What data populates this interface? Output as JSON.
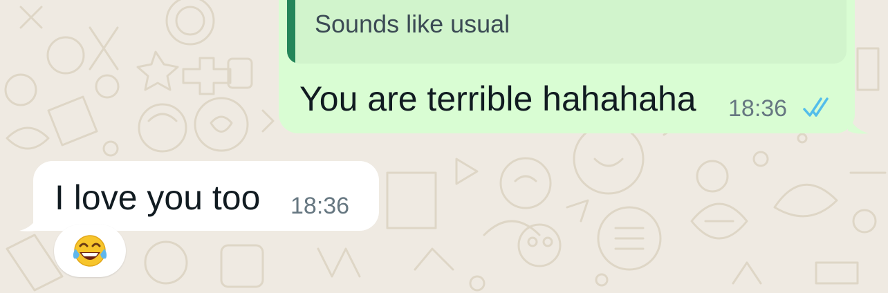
{
  "colors": {
    "chat_background": "#efeae2",
    "outgoing_bubble": "#d9fdd3",
    "quoted_background": "#d1f4cc",
    "quote_bar": "#25865a",
    "incoming_bubble": "#ffffff",
    "read_ticks": "#53bdeb",
    "timestamp": "#667781"
  },
  "outgoing": {
    "quoted_text": "Sounds like usual",
    "text": "You are terrible hahahaha",
    "time": "18:36",
    "status_icon": "double-check-read-icon"
  },
  "incoming": {
    "text": "I love you too",
    "time": "18:36",
    "reaction_icon": "face-with-tears-of-joy-emoji"
  }
}
